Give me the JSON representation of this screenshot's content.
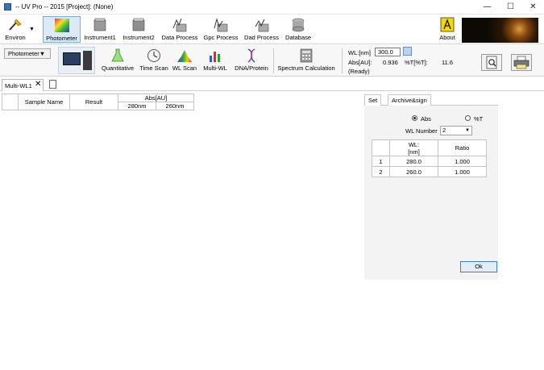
{
  "window": {
    "title": "-- UV Pro -- 2015 [Project]: (None)"
  },
  "toolbar": {
    "items": [
      {
        "label": "Environ",
        "icon": "environ-icon"
      },
      {
        "label": "Photometer",
        "icon": "photometer-icon",
        "active": true
      },
      {
        "label": "Instrument1",
        "icon": "instrument1-icon"
      },
      {
        "label": "Instrument2",
        "icon": "instrument2-icon"
      },
      {
        "label": "Data Process",
        "icon": "data-process-icon"
      },
      {
        "label": "Gpc Process",
        "icon": "gpc-process-icon"
      },
      {
        "label": "Dad Process",
        "icon": "dad-process-icon"
      },
      {
        "label": "Database",
        "icon": "database-icon"
      },
      {
        "label": "About",
        "icon": "about-icon"
      }
    ]
  },
  "toolbar2": {
    "mode_select": "Photometer▼",
    "items": [
      {
        "label": "Quantitative"
      },
      {
        "label": "Time Scan"
      },
      {
        "label": "WL Scan"
      },
      {
        "label": "Multi-WL"
      },
      {
        "label": "DNA/Protein"
      },
      {
        "label": "Spectrum Calculation"
      }
    ],
    "wl_label": "WL:[nm]",
    "wl_value": "300.0",
    "abs_label": "Abs[AU]:",
    "abs_value": "0.936",
    "percent_t_label": "%T[%T]:",
    "percent_t_value": "11.6",
    "status": "(Ready)"
  },
  "doc_tab": {
    "label": "Multi-WL1",
    "close": "✕"
  },
  "grid": {
    "headers": {
      "sample_name": "Sample Name",
      "result": "Result",
      "abs_group": "Abs[AU]"
    },
    "sub_headers": [
      "280nm",
      "260nm"
    ]
  },
  "right_panel": {
    "tabs": [
      "Set",
      "Archive&sign"
    ],
    "radio_abs": "Abs",
    "radio_t": "%T",
    "wl_number_label": "WL Number",
    "wl_number_value": "2",
    "table": {
      "headers": {
        "wl_line1": "WL:",
        "wl_line2": "[nm]",
        "ratio": "Ratio"
      },
      "rows": [
        {
          "index": "1",
          "wl": "280.0",
          "ratio": "1.000"
        },
        {
          "index": "2",
          "wl": "260.0",
          "ratio": "1.000"
        }
      ]
    },
    "ok_label": "Ok"
  }
}
